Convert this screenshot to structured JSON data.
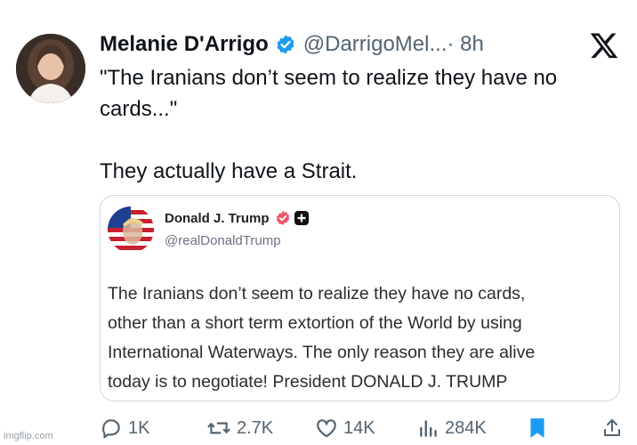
{
  "tweet": {
    "author_name": "Melanie D'Arrigo",
    "handle": "@DarrigoMel...",
    "time": "· 8h",
    "text_lines": [
      "\"The Iranians don’t seem to realize they have no",
      "cards...\"",
      "They actually have a Strait."
    ]
  },
  "quote": {
    "author_name": "Donald J. Trump",
    "handle": "@realDonaldTrump",
    "body_lines": [
      "The Iranians don’t seem to realize they have no cards,",
      "other than a short term extortion of the World by using",
      "International Waterways. The only reason they are alive",
      "today is to negotiate! President DONALD J. TRUMP"
    ]
  },
  "actions": {
    "replies": "1K",
    "reposts": "2.7K",
    "likes": "14K",
    "views": "284K"
  },
  "watermark": "imgflip.com",
  "colors": {
    "verified_blue": "#1d9bf0",
    "text_primary": "#0f1419",
    "text_secondary": "#536471",
    "border": "#cfd9de",
    "truth_badge": "#ee5568"
  },
  "icons": [
    "verified-badge-icon",
    "x-logo-icon",
    "reply-icon",
    "repost-icon",
    "like-icon",
    "views-icon",
    "bookmark-icon",
    "share-icon"
  ]
}
